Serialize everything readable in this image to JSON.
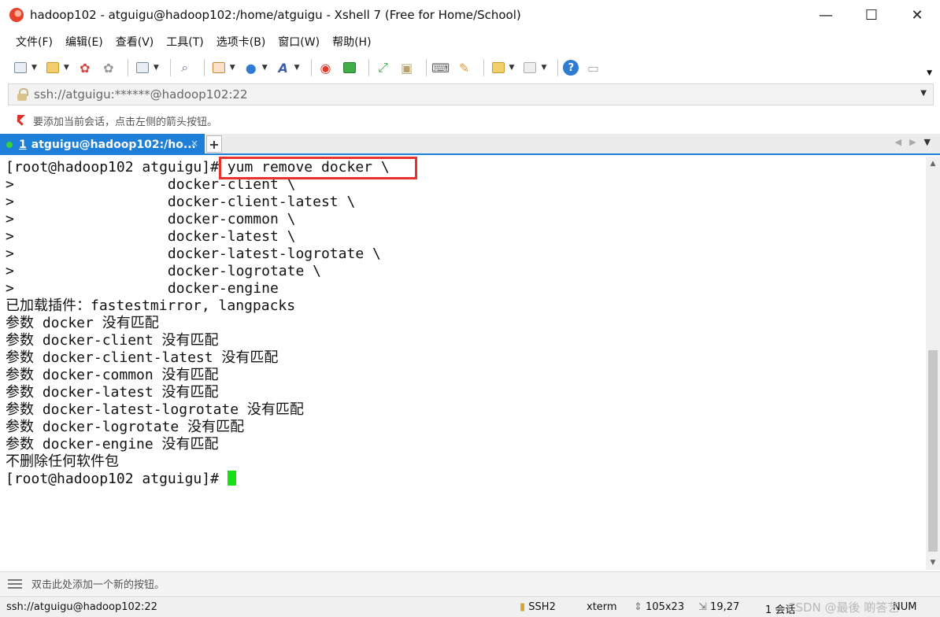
{
  "window": {
    "title": "hadoop102 - atguigu@hadoop102:/home/atguigu - Xshell 7 (Free for Home/School)",
    "controls": [
      "—",
      "☐",
      "✕"
    ]
  },
  "menu": [
    "文件(F)",
    "编辑(E)",
    "查看(V)",
    "工具(T)",
    "选项卡(B)",
    "窗口(W)",
    "帮助(H)"
  ],
  "address": {
    "text": "ssh://atguigu:******@hadoop102:22"
  },
  "quickbar": {
    "text": "要添加当前会话，点击左侧的箭头按钮。"
  },
  "tab": {
    "number": "1",
    "label": "atguigu@hadoop102:/ho...",
    "close": "×",
    "add": "+"
  },
  "terminal": {
    "prompt": "[root@hadoop102 atguigu]#",
    "command": " yum remove docker \\",
    "lines": [
      ">                  docker-client \\",
      ">                  docker-client-latest \\",
      ">                  docker-common \\",
      ">                  docker-latest \\",
      ">                  docker-latest-logrotate \\",
      ">                  docker-logrotate \\",
      ">                  docker-engine",
      "已加载插件：fastestmirror, langpacks",
      "参数 docker 没有匹配",
      "参数 docker-client 没有匹配",
      "参数 docker-client-latest 没有匹配",
      "参数 docker-common 没有匹配",
      "参数 docker-latest 没有匹配",
      "参数 docker-latest-logrotate 没有匹配",
      "参数 docker-logrotate 没有匹配",
      "参数 docker-engine 没有匹配",
      "不删除任何软件包"
    ],
    "last_prompt": "[root@hadoop102 atguigu]# "
  },
  "buttonbar": {
    "text": "双击此处添加一个新的按钮。"
  },
  "statusbar": {
    "connection": "ssh://atguigu@hadoop102:22",
    "protocol": "SSH2",
    "terminal_type": "xterm",
    "size": "105x23",
    "cursor_pos": "19,27",
    "sessions": "1 会话",
    "num": "NUM"
  },
  "watermark": "CSDN @最後 啲答艺",
  "colors": {
    "tab_active": "#1e7fd8",
    "cursor": "#18e018",
    "highlight_border": "#e8332c"
  }
}
